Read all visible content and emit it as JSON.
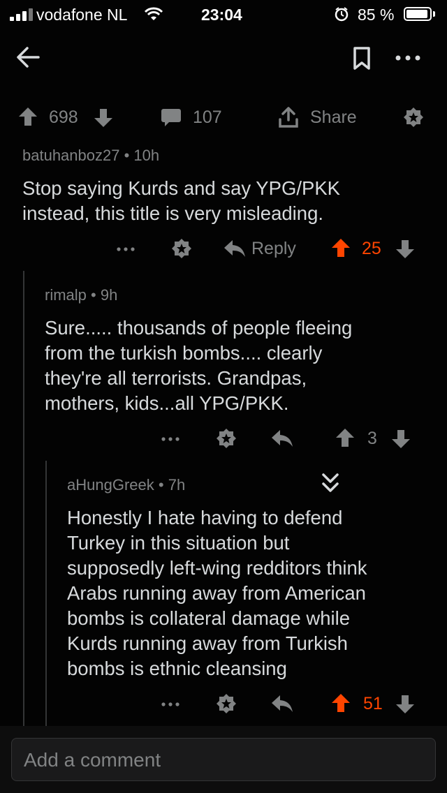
{
  "status": {
    "carrier": "vodafone NL",
    "time": "23:04",
    "battery": "85 %"
  },
  "post_bar": {
    "upvotes": "698",
    "comments": "107",
    "share": "Share"
  },
  "comments": [
    {
      "author": "batuhanboz27",
      "age": "10h",
      "body": [
        "Stop saying Kurds and say YPG/PKK",
        "instead, this title is very misleading."
      ],
      "reply_label": "Reply",
      "score": "25",
      "upvoted": true
    },
    {
      "author": "rimalp",
      "age": "9h",
      "body": [
        "Sure..... thousands of people fleeing",
        "from the turkish bombs.... clearly",
        "they're all terrorists. Grandpas,",
        "mothers, kids...all YPG/PKK."
      ],
      "score": "3",
      "upvoted": false
    },
    {
      "author": "aHungGreek",
      "age": "7h",
      "body": [
        "Honestly I hate having to defend",
        "Turkey in this situation but",
        "supposedly left-wing redditors think",
        "Arabs running away from American",
        "bombs is collateral damage while",
        "Kurds running away from Turkish",
        "bombs is ethnic cleansing"
      ],
      "score": "51",
      "upvoted": true
    }
  ],
  "composer": {
    "placeholder": "Add a comment"
  },
  "colors": {
    "background": "#030303",
    "text": "#d7dadc",
    "meta": "#818384",
    "upvote": "#ff4500"
  },
  "icons": {
    "back": "arrow-left-icon",
    "save": "bookmark-icon",
    "more": "ellipsis-icon",
    "upvote": "arrow-up-icon",
    "downvote": "arrow-down-icon",
    "comment": "speech-bubble-icon",
    "share": "share-icon",
    "award": "award-star-icon",
    "reply": "reply-arrow-icon",
    "collapse": "double-chevron-down-icon"
  }
}
